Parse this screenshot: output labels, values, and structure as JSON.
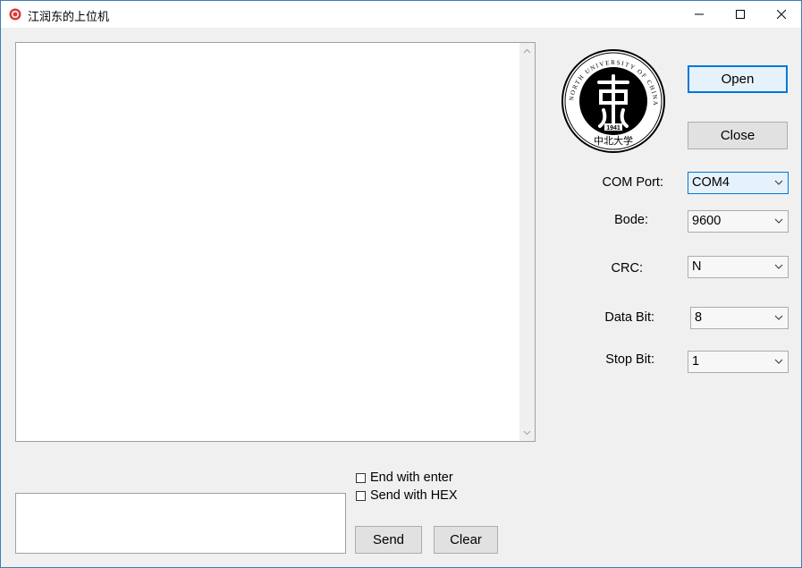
{
  "window": {
    "title": "江润东的上位机"
  },
  "logo": {
    "text": "NORTH UNIVERSITY OF CHINA",
    "year": "1941",
    "chinese": "中北大学"
  },
  "buttons": {
    "open": "Open",
    "close": "Close",
    "send": "Send",
    "clear": "Clear"
  },
  "settings": {
    "com_port": {
      "label": "COM Port:",
      "value": "COM4"
    },
    "bode": {
      "label": "Bode:",
      "value": "9600"
    },
    "crc": {
      "label": "CRC:",
      "value": "N"
    },
    "data_bit": {
      "label": "Data Bit:",
      "value": "8"
    },
    "stop_bit": {
      "label": "Stop Bit:",
      "value": "1"
    }
  },
  "options": {
    "end_with_enter": {
      "label": "End with enter",
      "checked": false
    },
    "send_with_hex": {
      "label": "Send with HEX",
      "checked": false
    }
  },
  "receive_area": {
    "value": ""
  },
  "send_area": {
    "value": ""
  },
  "colors": {
    "accent": "#0078d7"
  }
}
